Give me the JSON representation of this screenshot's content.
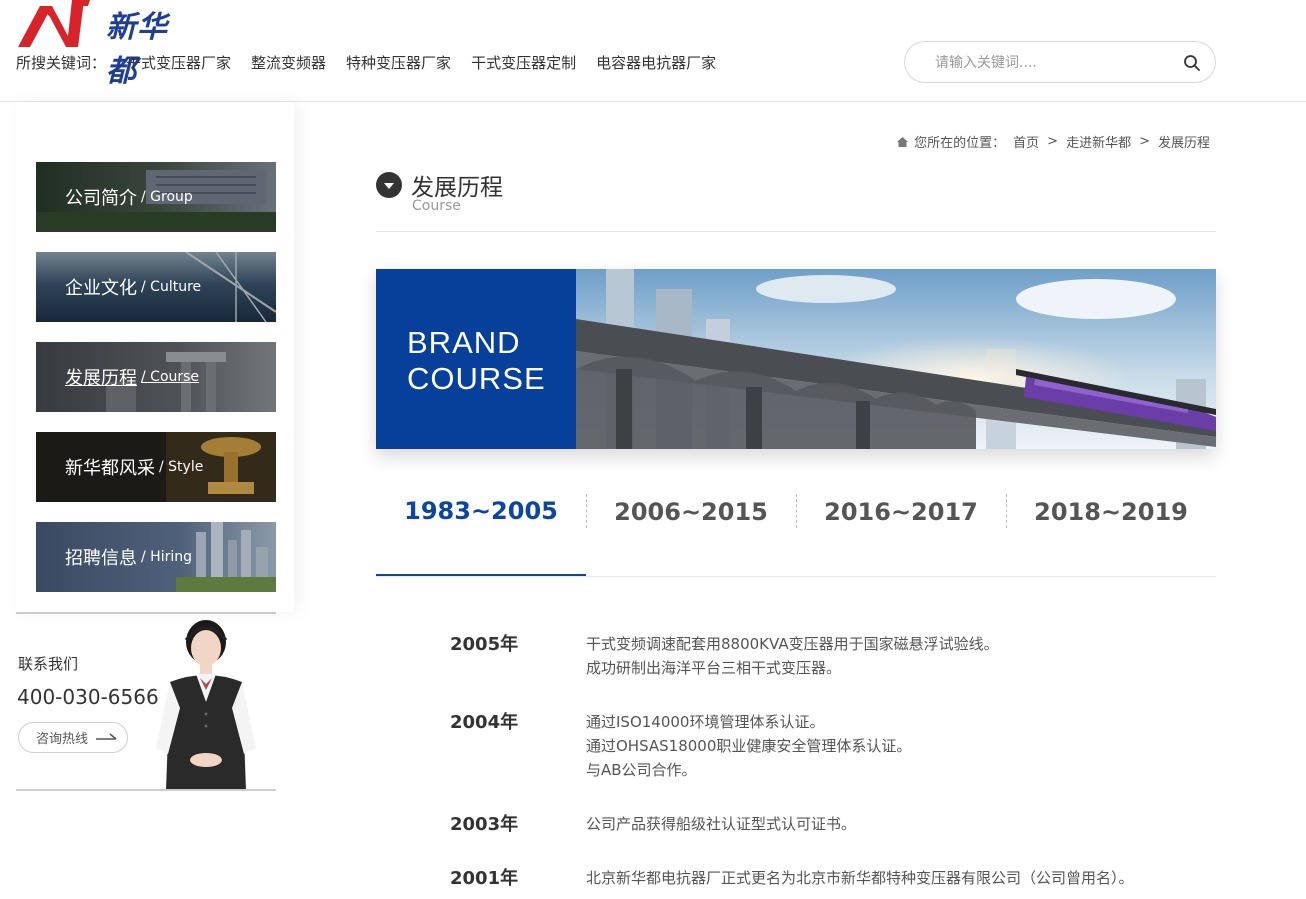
{
  "header": {
    "logo_text": "新华都",
    "keyword_label": "所搜关键词：",
    "keywords": [
      "干式变压器厂家",
      "整流变频器",
      "特种变压器厂家",
      "干式变压器定制",
      "电容器电抗器厂家"
    ],
    "search_placeholder": "请输入关键词...."
  },
  "sidebar": {
    "items": [
      {
        "zh": "公司简介",
        "en": "/ Group"
      },
      {
        "zh": "企业文化",
        "en": "/ Culture"
      },
      {
        "zh": "发展历程",
        "en": "/ Course"
      },
      {
        "zh": "新华都风采",
        "en": "/ Style"
      },
      {
        "zh": "招聘信息",
        "en": "/ Hiring"
      }
    ],
    "active_index": 2
  },
  "contact": {
    "title": "联系我们",
    "phone": "400-030-6566",
    "button_label": "咨询热线"
  },
  "breadcrumb": {
    "label": "您所在的位置：",
    "items": [
      "首页",
      "走进新华都",
      "发展历程"
    ],
    "separator": ">"
  },
  "page": {
    "title": "发展历程",
    "subtitle": "Course"
  },
  "banner": {
    "line1": "BRAND",
    "line2": "COURSE",
    "accent_color": "#06409a"
  },
  "tabs": [
    {
      "label": "1983~2005",
      "active": true
    },
    {
      "label": "2006~2015",
      "active": false
    },
    {
      "label": "2016~2017",
      "active": false
    },
    {
      "label": "2018~2019",
      "active": false
    }
  ],
  "timeline": [
    {
      "year": "2005年",
      "lines": [
        "干式变频调速配套用8800KVA变压器用于国家磁悬浮试验线。",
        "成功研制出海洋平台三相干式变压器。"
      ]
    },
    {
      "year": "2004年",
      "lines": [
        "通过ISO14000环境管理体系认证。",
        "通过OHSAS18000职业健康安全管理体系认证。",
        "与AB公司合作。"
      ]
    },
    {
      "year": "2003年",
      "lines": [
        "公司产品获得船级社认证型式认可证书。"
      ]
    },
    {
      "year": "2001年",
      "lines": [
        "北京新华都电抗器厂正式更名为北京市新华都特种变压器有限公司（公司曾用名）。"
      ]
    }
  ]
}
